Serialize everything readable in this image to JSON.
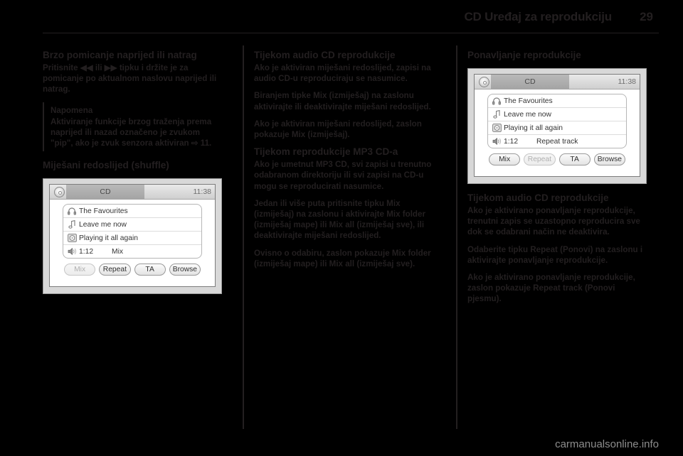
{
  "header": {
    "title": "CD Uređaj za reprodukciju",
    "page_number": "29"
  },
  "footer": {
    "watermark": "carmanualsonline.info"
  },
  "columns": {
    "left": {
      "heading": "Brzo pomicanje naprijed ili natrag",
      "paragraph": "Pritisnite ◀◀ ili ▶▶ tipku i držite je za pomicanje po aktualnom naslovu naprijed ili natrag.",
      "note": {
        "title": "Napomena",
        "text": "Aktiviranje funkcije brzog traženja prema naprijed ili nazad označeno je zvukom \"pip\", ako je zvuk senzora aktiviran ⇨ 11."
      },
      "heading2": "Miješani redoslijed (shuffle)"
    },
    "middle": {
      "heading1": "Tijekom audio CD reprodukcije",
      "p1": "Ako je aktiviran miješani redoslijed, zapisi na audio CD-u reproduciraju se nasumice.",
      "p2": "Biranjem tipke Mix (izmiješaj) na zaslonu aktivirajte ili deaktivirajte miješani redoslijed.",
      "p3": "Ako je aktiviran miješani redoslijed, zaslon pokazuje Mix (izmiješaj).",
      "heading2": "Tijekom reprodukcije MP3 CD-a",
      "p4": "Ako je umetnut MP3 CD, svi zapisi u trenutno odabranom direktoriju ili svi zapisi na CD-u mogu se reproducirati nasumice.",
      "p5": "Jedan ili više puta pritisnite tipku Mix (izmiješaj) na zaslonu i aktivirajte Mix folder (izmiješaj mape) ili Mix all (izmiješaj sve), ili deaktivirajte miješani redoslijed.",
      "p6": "Ovisno o odabiru, zaslon pokazuje Mix folder (izmiješaj mape) ili Mix all (izmiješaj sve)."
    },
    "right": {
      "heading1": "Ponavljanje reprodukcije",
      "heading2": "Tijekom audio CD reprodukcije",
      "p1": "Ako je aktivirano ponavljanje reprodukcije, trenutni zapis se uzastopno reproducira sve dok se odabrani način ne deaktivira.",
      "p2": "Odaberite tipku Repeat (Ponovi) na zaslonu i aktivirajte ponavljanje reprodukcije.",
      "p3": "Ako je aktivirano ponavljanje reprodukcije, zaslon pokazuje Repeat track (Ponovi pjesmu)."
    }
  },
  "screenshot_mix": {
    "source_label": "CD",
    "clock": "11:38",
    "rows": [
      {
        "icon": "headphones-icon",
        "label": "The Favourites"
      },
      {
        "icon": "music-note-icon",
        "label": "Leave me now"
      },
      {
        "icon": "disc-icon",
        "label": "Playing it all again"
      }
    ],
    "status": {
      "icon": "speaker-icon",
      "time": "1:12",
      "mode": "Mix"
    },
    "buttons": [
      {
        "label": "Mix",
        "disabled": true
      },
      {
        "label": "Repeat",
        "disabled": false
      },
      {
        "label": "TA",
        "disabled": false
      },
      {
        "label": "Browse",
        "disabled": false
      }
    ]
  },
  "screenshot_repeat": {
    "source_label": "CD",
    "clock": "11:38",
    "rows": [
      {
        "icon": "headphones-icon",
        "label": "The Favourites"
      },
      {
        "icon": "music-note-icon",
        "label": "Leave me now"
      },
      {
        "icon": "disc-icon",
        "label": "Playing it all again"
      }
    ],
    "status": {
      "icon": "speaker-icon",
      "time": "1:12",
      "mode": "Repeat track"
    },
    "buttons": [
      {
        "label": "Mix",
        "disabled": false
      },
      {
        "label": "Repeat",
        "disabled": true
      },
      {
        "label": "TA",
        "disabled": false
      },
      {
        "label": "Browse",
        "disabled": false
      }
    ]
  }
}
